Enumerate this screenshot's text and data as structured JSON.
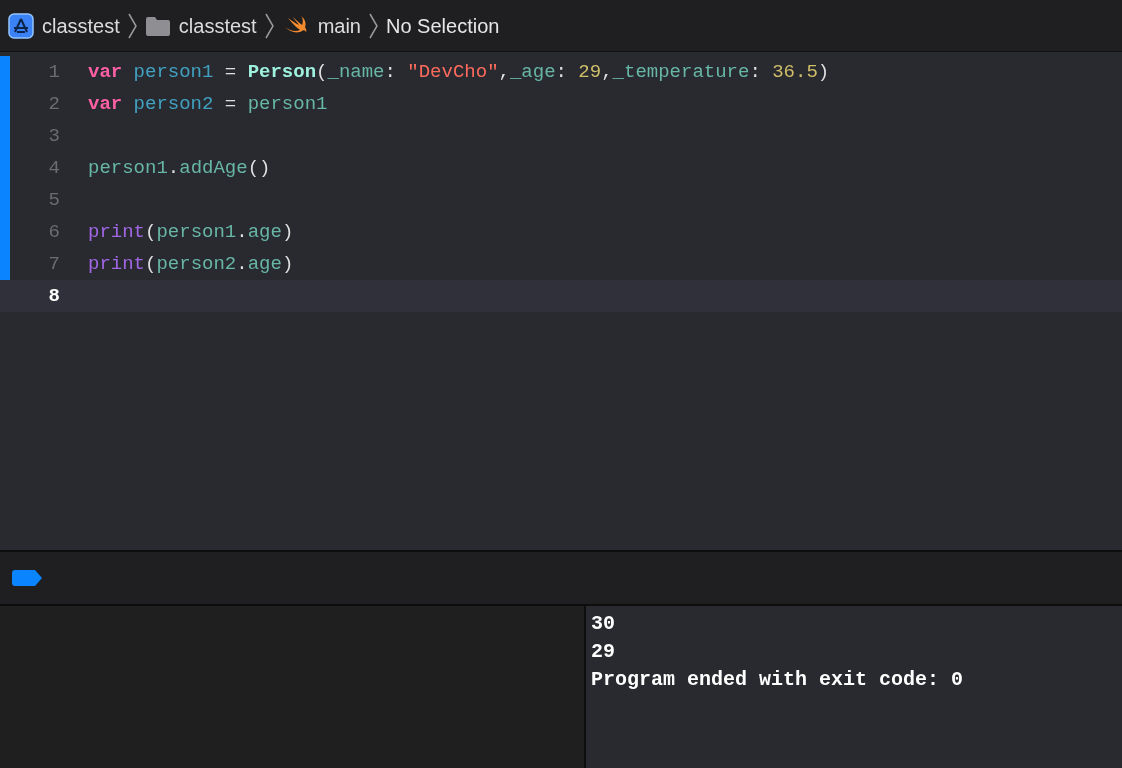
{
  "breadcrumb": [
    {
      "kind": "project",
      "label": "classtest"
    },
    {
      "kind": "folder",
      "label": "classtest"
    },
    {
      "kind": "swift",
      "label": "main"
    },
    {
      "kind": "plain",
      "label": "No Selection"
    }
  ],
  "editor": {
    "lines": [
      {
        "number": "1",
        "changed": true,
        "current": false,
        "tokens": [
          {
            "kind": "keyword",
            "text": "var "
          },
          {
            "kind": "decl",
            "text": "person1"
          },
          {
            "kind": "plain",
            "text": " = "
          },
          {
            "kind": "type",
            "text": "Person"
          },
          {
            "kind": "plain",
            "text": "("
          },
          {
            "kind": "ident",
            "text": "_name"
          },
          {
            "kind": "plain",
            "text": ": "
          },
          {
            "kind": "string",
            "text": "\"DevCho\""
          },
          {
            "kind": "plain",
            "text": ","
          },
          {
            "kind": "ident",
            "text": "_age"
          },
          {
            "kind": "plain",
            "text": ": "
          },
          {
            "kind": "number",
            "text": "29"
          },
          {
            "kind": "plain",
            "text": ","
          },
          {
            "kind": "ident",
            "text": "_temperature"
          },
          {
            "kind": "plain",
            "text": ": "
          },
          {
            "kind": "number",
            "text": "36.5"
          },
          {
            "kind": "plain",
            "text": ")"
          }
        ]
      },
      {
        "number": "2",
        "changed": true,
        "current": false,
        "tokens": [
          {
            "kind": "keyword",
            "text": "var "
          },
          {
            "kind": "decl",
            "text": "person2"
          },
          {
            "kind": "plain",
            "text": " = "
          },
          {
            "kind": "ident",
            "text": "person1"
          }
        ]
      },
      {
        "number": "3",
        "changed": true,
        "current": false
      },
      {
        "number": "4",
        "changed": true,
        "current": false,
        "tokens": [
          {
            "kind": "ident",
            "text": "person1"
          },
          {
            "kind": "plain",
            "text": "."
          },
          {
            "kind": "ident",
            "text": "addAge"
          },
          {
            "kind": "plain",
            "text": "()"
          }
        ]
      },
      {
        "number": "5",
        "changed": true,
        "current": false
      },
      {
        "number": "6",
        "changed": true,
        "current": false,
        "tokens": [
          {
            "kind": "func",
            "text": "print"
          },
          {
            "kind": "plain",
            "text": "("
          },
          {
            "kind": "ident",
            "text": "person1"
          },
          {
            "kind": "plain",
            "text": "."
          },
          {
            "kind": "ident",
            "text": "age"
          },
          {
            "kind": "plain",
            "text": ")"
          }
        ]
      },
      {
        "number": "7",
        "changed": true,
        "current": false,
        "tokens": [
          {
            "kind": "func",
            "text": "print"
          },
          {
            "kind": "plain",
            "text": "("
          },
          {
            "kind": "ident",
            "text": "person2"
          },
          {
            "kind": "plain",
            "text": "."
          },
          {
            "kind": "ident",
            "text": "age"
          },
          {
            "kind": "plain",
            "text": ")"
          }
        ]
      },
      {
        "number": "8",
        "changed": false,
        "current": true
      }
    ]
  },
  "debug_bar": {
    "breakpoints_active": true
  },
  "console": {
    "lines": [
      "30",
      "29",
      "Program ended with exit code: 0"
    ]
  }
}
